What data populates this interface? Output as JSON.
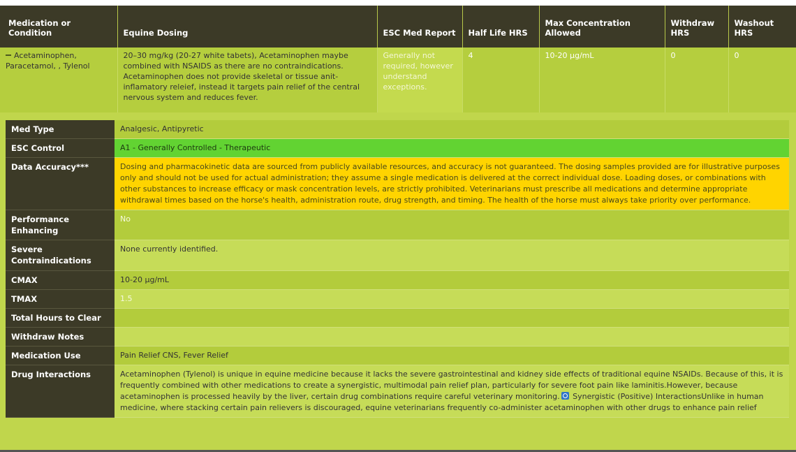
{
  "header": {
    "columns": [
      "Medication or Condition",
      "Equine Dosing",
      "ESC Med Report",
      "Half Life HRS",
      "Max Concentration Allowed",
      "Withdraw HRS",
      "Washout HRS"
    ]
  },
  "row": {
    "medication": "Acetaminophen, Paracetamol, , Tylenol",
    "dosing": "20–30 mg/kg (20-27 white tabets), Acetaminophen maybe combined with NSAIDS as there are no contraindications. Acetaminophen does not provide skeletal or tissue anit-inflamatory releief, instead it targets pain relief of the central nervous system and reduces fever.",
    "esc_report": "Generally not required, however understand exceptions.",
    "half_life": "4",
    "max_concentration": "10-20 µg/mL",
    "withdraw": "0",
    "washout": "0"
  },
  "details": {
    "med_type": {
      "label": "Med Type",
      "value": "Analgesic, Antipyretic"
    },
    "esc_control": {
      "label": "ESC Control",
      "value": "A1 - Generally Controlled - Therapeutic"
    },
    "data_accuracy": {
      "label": "Data Accuracy***",
      "value": "Dosing and pharmacokinetic data are sourced from publicly available resources, and accuracy is not guaranteed. The dosing samples provided are for illustrative purposes only and should not be used for actual administration; they assume a single medication is delivered at the correct individual dose. Loading doses, or combinations with other substances to increase efficacy or mask concentration levels, are strictly prohibited. Veterinarians must prescribe all medications and determine appropriate withdrawal times based on the horse's health, administration route, drug strength, and timing. The health of the horse must always take priority over performance."
    },
    "performance": {
      "label": "Performance Enhancing",
      "value": "No"
    },
    "contraindications": {
      "label": "Severe Contraindications",
      "value": "None currently identified."
    },
    "cmax": {
      "label": "CMAX",
      "value": "10-20 µg/mL"
    },
    "tmax": {
      "label": "TMAX",
      "value": "1.5"
    },
    "total_hours": {
      "label": "Total Hours to Clear",
      "value": ""
    },
    "withdraw_notes": {
      "label": "Withdraw Notes",
      "value": ""
    },
    "medication_use": {
      "label": "Medication Use",
      "value": "Pain Relief CNS, Fever Relief"
    },
    "drug_interactions": {
      "label": "Drug Interactions",
      "value_part1": "Acetaminophen (Tylenol) is unique in equine medicine because it lacks the severe gastrointestinal and kidney side effects of traditional equine NSAIDs. Because of this, it is frequently combined with other medications to create a synergistic, multimodal pain relief plan, particularly for severe foot pain like laminitis.However, because acetaminophen is processed heavily by the liver, certain drug combinations require careful veterinary monitoring.",
      "value_part2": " Synergistic (Positive) InteractionsUnlike in human medicine, where stacking certain pain relievers is discouraged, equine veterinarians frequently co-administer acetaminophen with other drugs to enhance pain relief"
    }
  },
  "icons": {
    "collapse": "minus-icon",
    "inline": "info-icon"
  },
  "colors": {
    "header_bg": "#3c3a27",
    "row_bg": "#b5ce3e",
    "control_green": "#62d332",
    "accuracy_yellow": "#ffd400"
  }
}
